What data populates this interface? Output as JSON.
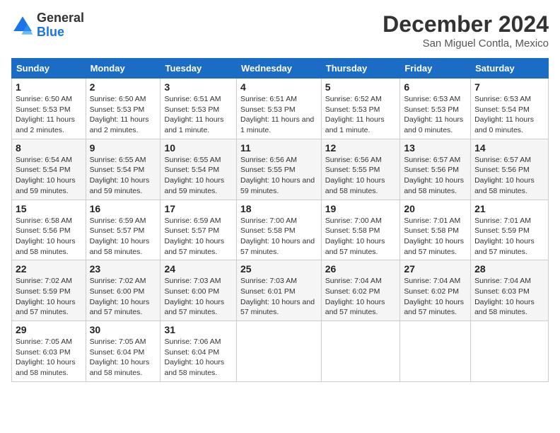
{
  "header": {
    "logo": {
      "general": "General",
      "blue": "Blue"
    },
    "title": "December 2024",
    "location": "San Miguel Contla, Mexico"
  },
  "calendar": {
    "days_of_week": [
      "Sunday",
      "Monday",
      "Tuesday",
      "Wednesday",
      "Thursday",
      "Friday",
      "Saturday"
    ],
    "weeks": [
      [
        {
          "day": 1,
          "sunrise": "6:50 AM",
          "sunset": "5:53 PM",
          "daylight": "11 hours and 2 minutes."
        },
        {
          "day": 2,
          "sunrise": "6:50 AM",
          "sunset": "5:53 PM",
          "daylight": "11 hours and 2 minutes."
        },
        {
          "day": 3,
          "sunrise": "6:51 AM",
          "sunset": "5:53 PM",
          "daylight": "11 hours and 1 minute."
        },
        {
          "day": 4,
          "sunrise": "6:51 AM",
          "sunset": "5:53 PM",
          "daylight": "11 hours and 1 minute."
        },
        {
          "day": 5,
          "sunrise": "6:52 AM",
          "sunset": "5:53 PM",
          "daylight": "11 hours and 1 minute."
        },
        {
          "day": 6,
          "sunrise": "6:53 AM",
          "sunset": "5:53 PM",
          "daylight": "11 hours and 0 minutes."
        },
        {
          "day": 7,
          "sunrise": "6:53 AM",
          "sunset": "5:54 PM",
          "daylight": "11 hours and 0 minutes."
        }
      ],
      [
        {
          "day": 8,
          "sunrise": "6:54 AM",
          "sunset": "5:54 PM",
          "daylight": "10 hours and 59 minutes."
        },
        {
          "day": 9,
          "sunrise": "6:55 AM",
          "sunset": "5:54 PM",
          "daylight": "10 hours and 59 minutes."
        },
        {
          "day": 10,
          "sunrise": "6:55 AM",
          "sunset": "5:54 PM",
          "daylight": "10 hours and 59 minutes."
        },
        {
          "day": 11,
          "sunrise": "6:56 AM",
          "sunset": "5:55 PM",
          "daylight": "10 hours and 59 minutes."
        },
        {
          "day": 12,
          "sunrise": "6:56 AM",
          "sunset": "5:55 PM",
          "daylight": "10 hours and 58 minutes."
        },
        {
          "day": 13,
          "sunrise": "6:57 AM",
          "sunset": "5:56 PM",
          "daylight": "10 hours and 58 minutes."
        },
        {
          "day": 14,
          "sunrise": "6:57 AM",
          "sunset": "5:56 PM",
          "daylight": "10 hours and 58 minutes."
        }
      ],
      [
        {
          "day": 15,
          "sunrise": "6:58 AM",
          "sunset": "5:56 PM",
          "daylight": "10 hours and 58 minutes."
        },
        {
          "day": 16,
          "sunrise": "6:59 AM",
          "sunset": "5:57 PM",
          "daylight": "10 hours and 58 minutes."
        },
        {
          "day": 17,
          "sunrise": "6:59 AM",
          "sunset": "5:57 PM",
          "daylight": "10 hours and 57 minutes."
        },
        {
          "day": 18,
          "sunrise": "7:00 AM",
          "sunset": "5:58 PM",
          "daylight": "10 hours and 57 minutes."
        },
        {
          "day": 19,
          "sunrise": "7:00 AM",
          "sunset": "5:58 PM",
          "daylight": "10 hours and 57 minutes."
        },
        {
          "day": 20,
          "sunrise": "7:01 AM",
          "sunset": "5:58 PM",
          "daylight": "10 hours and 57 minutes."
        },
        {
          "day": 21,
          "sunrise": "7:01 AM",
          "sunset": "5:59 PM",
          "daylight": "10 hours and 57 minutes."
        }
      ],
      [
        {
          "day": 22,
          "sunrise": "7:02 AM",
          "sunset": "5:59 PM",
          "daylight": "10 hours and 57 minutes."
        },
        {
          "day": 23,
          "sunrise": "7:02 AM",
          "sunset": "6:00 PM",
          "daylight": "10 hours and 57 minutes."
        },
        {
          "day": 24,
          "sunrise": "7:03 AM",
          "sunset": "6:00 PM",
          "daylight": "10 hours and 57 minutes."
        },
        {
          "day": 25,
          "sunrise": "7:03 AM",
          "sunset": "6:01 PM",
          "daylight": "10 hours and 57 minutes."
        },
        {
          "day": 26,
          "sunrise": "7:04 AM",
          "sunset": "6:02 PM",
          "daylight": "10 hours and 57 minutes."
        },
        {
          "day": 27,
          "sunrise": "7:04 AM",
          "sunset": "6:02 PM",
          "daylight": "10 hours and 57 minutes."
        },
        {
          "day": 28,
          "sunrise": "7:04 AM",
          "sunset": "6:03 PM",
          "daylight": "10 hours and 58 minutes."
        }
      ],
      [
        {
          "day": 29,
          "sunrise": "7:05 AM",
          "sunset": "6:03 PM",
          "daylight": "10 hours and 58 minutes."
        },
        {
          "day": 30,
          "sunrise": "7:05 AM",
          "sunset": "6:04 PM",
          "daylight": "10 hours and 58 minutes."
        },
        {
          "day": 31,
          "sunrise": "7:06 AM",
          "sunset": "6:04 PM",
          "daylight": "10 hours and 58 minutes."
        },
        null,
        null,
        null,
        null
      ]
    ]
  }
}
